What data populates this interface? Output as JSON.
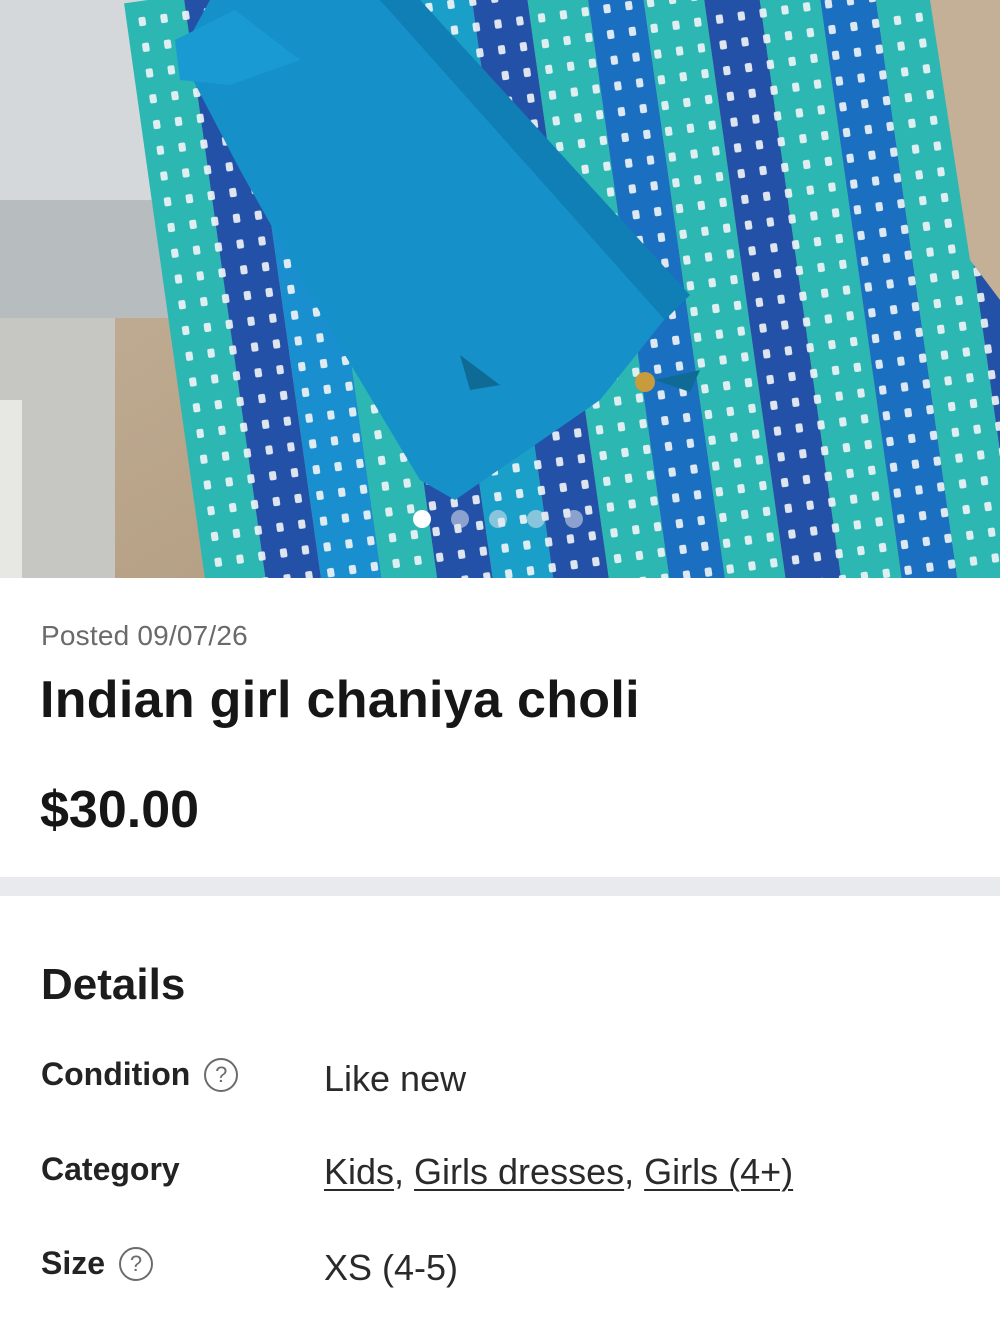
{
  "listing": {
    "photo": {
      "alt_icon": "product-photo",
      "slide_count": 5,
      "active_slide": 1
    },
    "posted": "Posted 09/07/26",
    "title": "Indian girl chaniya choli",
    "price": "$30.00"
  },
  "details": {
    "heading": "Details",
    "condition": {
      "label": "Condition",
      "value": "Like new",
      "help_icon": "question-circle-icon"
    },
    "category": {
      "label": "Category",
      "links": [
        "Kids",
        "Girls dresses",
        "Girls (4+)"
      ],
      "separator": ", "
    },
    "size": {
      "label": "Size",
      "value": "XS (4-5)",
      "help_icon": "question-circle-icon"
    }
  },
  "colors": {
    "fabric_teal": "#1aa0c8",
    "fabric_blue": "#2451a8",
    "fabric_aqua": "#2cb7b3",
    "divider": "#e9eaee"
  }
}
